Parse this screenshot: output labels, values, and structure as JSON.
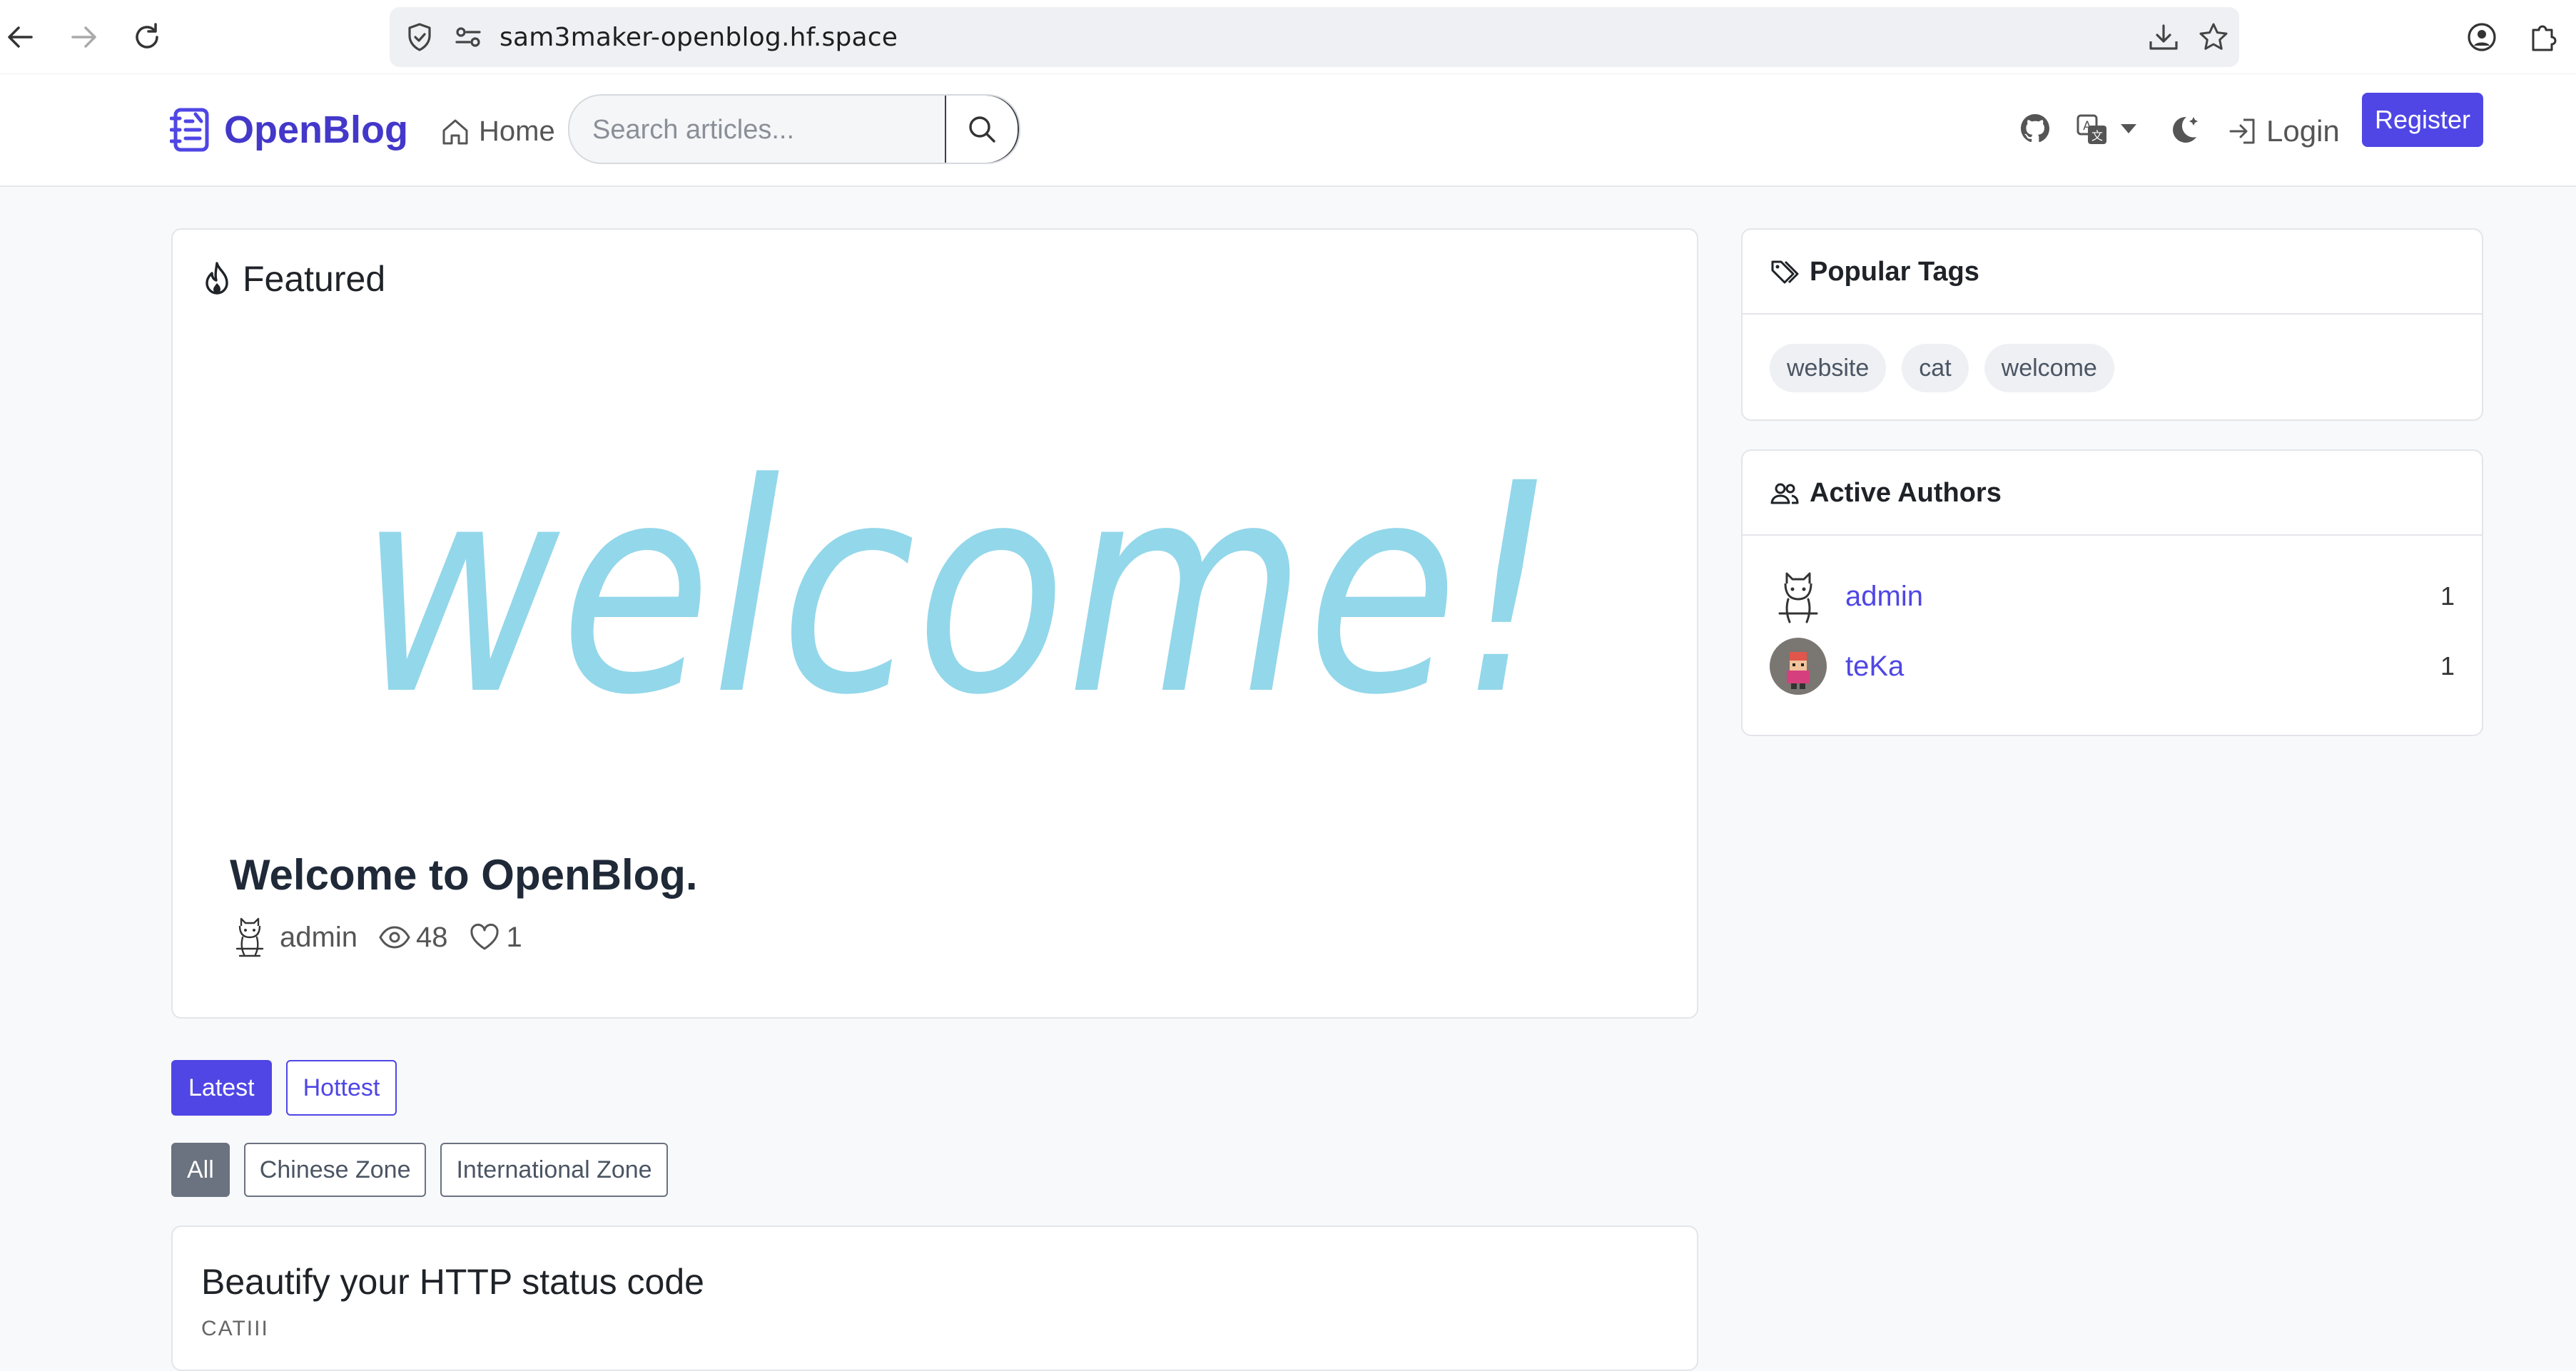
{
  "browser": {
    "url": "sam3maker-openblog.hf.space"
  },
  "nav": {
    "brand": "OpenBlog",
    "home_label": "Home",
    "search_placeholder": "Search articles...",
    "login_label": "Login",
    "register_label": "Register"
  },
  "featured": {
    "heading": "Featured",
    "image_text": "welcome!",
    "post_title": "Welcome to OpenBlog.",
    "author": "admin",
    "views": "48",
    "likes": "1"
  },
  "sort_tabs": [
    {
      "label": "Latest",
      "active": true
    },
    {
      "label": "Hottest",
      "active": false
    }
  ],
  "zones": [
    {
      "label": "All",
      "active": true
    },
    {
      "label": "Chinese Zone",
      "active": false
    },
    {
      "label": "International Zone",
      "active": false
    }
  ],
  "articles": [
    {
      "title": "Beautify your HTTP status code",
      "snippet": "CATIII"
    }
  ],
  "sidebar": {
    "tags_heading": "Popular Tags",
    "tags": [
      "website",
      "cat",
      "welcome"
    ],
    "authors_heading": "Active Authors",
    "authors": [
      {
        "name": "admin",
        "count": "1"
      },
      {
        "name": "teKa",
        "count": "1"
      }
    ]
  },
  "colors": {
    "accent": "#4f46e5",
    "welcome_image": "#93d7ea",
    "page_bg": "#f8f9fb"
  }
}
